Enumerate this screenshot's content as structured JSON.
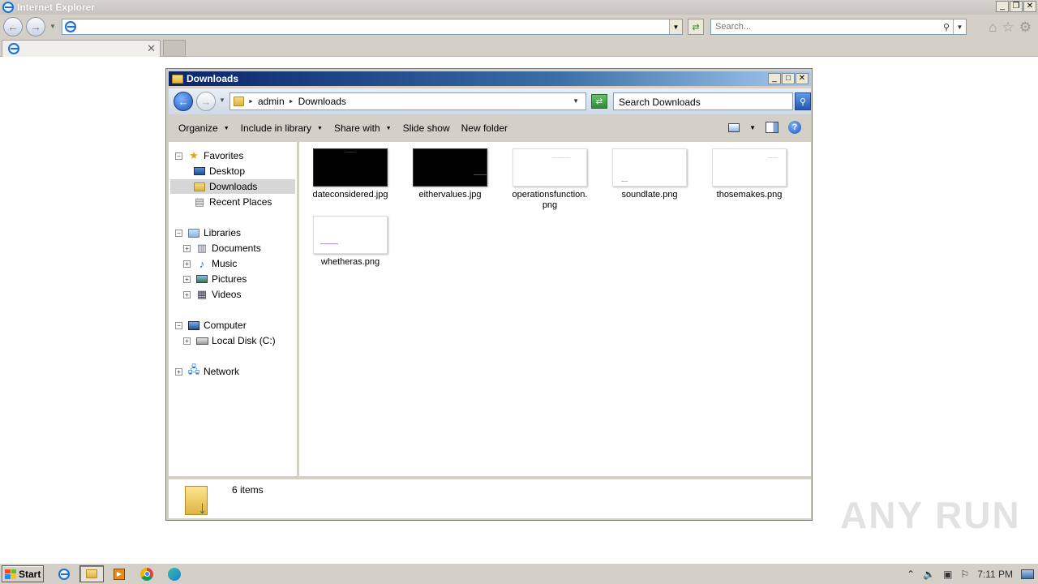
{
  "browser": {
    "title": "Internet Explorer",
    "address_value": "",
    "search_placeholder": "Search...",
    "tab_title": ""
  },
  "explorer": {
    "title": "Downloads",
    "breadcrumb": [
      "admin",
      "Downloads"
    ],
    "search_placeholder": "Search Downloads",
    "commands": [
      "Organize",
      "Include in library",
      "Share with",
      "Slide show",
      "New folder"
    ],
    "nav": {
      "favorites": "Favorites",
      "desktop": "Desktop",
      "downloads": "Downloads",
      "recent": "Recent Places",
      "libraries": "Libraries",
      "documents": "Documents",
      "music": "Music",
      "pictures": "Pictures",
      "videos": "Videos",
      "computer": "Computer",
      "local_disk": "Local Disk (C:)",
      "network": "Network"
    },
    "files": [
      {
        "name": "dateconsidered.jpg"
      },
      {
        "name": "eithervalues.jpg"
      },
      {
        "name": "operationsfunction.\npng"
      },
      {
        "name": "soundlate.png"
      },
      {
        "name": "thosemakes.png"
      },
      {
        "name": "whetheras.png"
      }
    ],
    "item_count": "6 items"
  },
  "watermark": "ANY RUN",
  "taskbar": {
    "start_label": "Start",
    "clock": "7:11 PM"
  }
}
